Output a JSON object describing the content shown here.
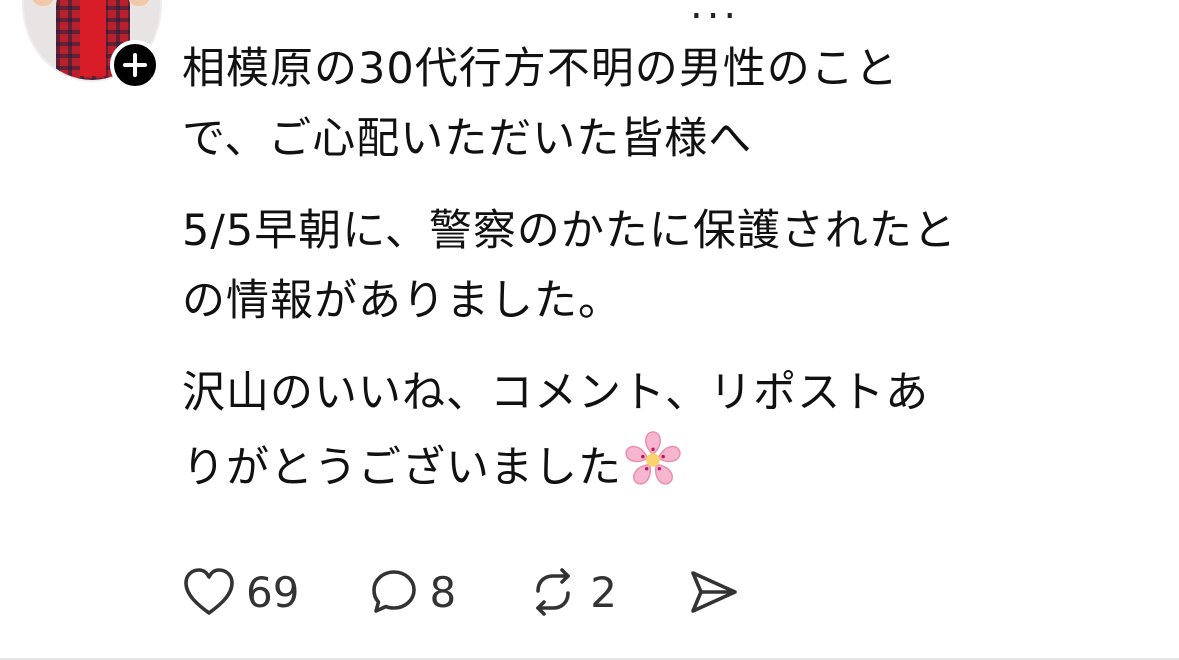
{
  "post": {
    "header_clip": "...",
    "paragraphs": [
      {
        "lines": [
          "相模原の30代行方不明の男性のこと",
          "で、ご心配いただいた皆様へ"
        ]
      },
      {
        "lines": [
          "5/5早朝に、警察のかたに保護されたと",
          "の情報がありました。"
        ]
      },
      {
        "lines": [
          "沢山のいいね、コメント、リポストあ",
          "りがとうございました"
        ]
      }
    ],
    "emoji": "cherry-blossom-emoji"
  },
  "actions": {
    "like_count": "69",
    "comment_count": "8",
    "repost_count": "2"
  },
  "icons": {
    "follow": "plus-icon",
    "like": "heart-icon",
    "comment": "speech-bubble-icon",
    "repost": "repost-arrows-icon",
    "share": "send-icon"
  },
  "colors": {
    "text": "#111111",
    "icon": "#333333",
    "badge": "#000000",
    "blossom": "#f7b6cf"
  }
}
